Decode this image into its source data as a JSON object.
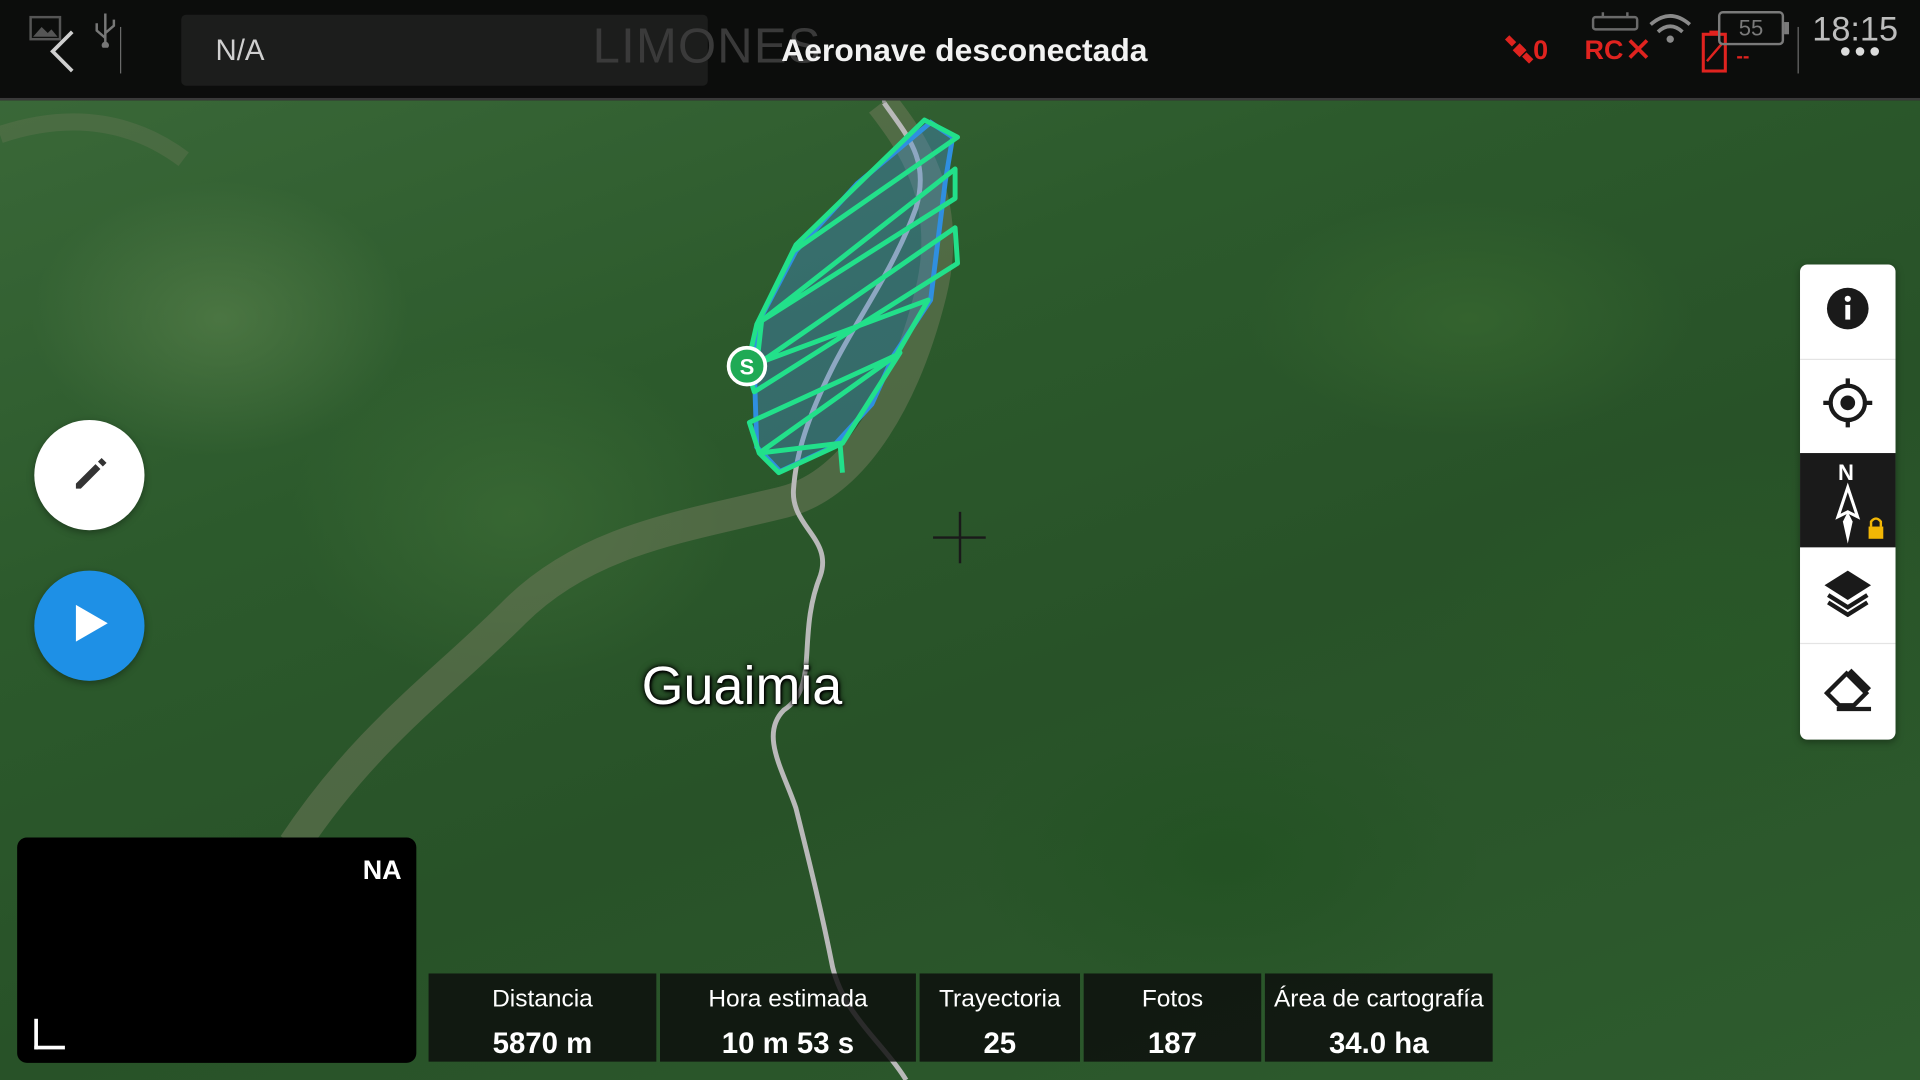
{
  "topbar": {
    "device_label": "N/A",
    "map_place": "LIMONES",
    "status": "Aeronave desconectada",
    "satellites": "0",
    "rc_label": "RC",
    "aircraft_battery": "--",
    "rc_battery": "55",
    "time": "18:15"
  },
  "map": {
    "place_label": "Guaimia",
    "start_marker": "S"
  },
  "mini_view": {
    "label": "NA"
  },
  "tools": [
    {
      "name": "info-icon"
    },
    {
      "name": "locate-icon"
    },
    {
      "name": "compass-north-lock-icon",
      "label": "N"
    },
    {
      "name": "map-layers-icon"
    },
    {
      "name": "eraser-icon"
    }
  ],
  "stats": {
    "distance_label": "Distancia",
    "distance_value": "5870 m",
    "time_label": "Hora estimada",
    "time_value": "10 m 53 s",
    "trajectory_label": "Trayectoria",
    "trajectory_value": "25",
    "photos_label": "Fotos",
    "photos_value": "187",
    "area_label": "Área de cartografía",
    "area_value": "34.0 ha"
  },
  "colors": {
    "accent_blue": "#1e90e6",
    "survey_area": "#2f8fe0",
    "flight_path": "#22e08a",
    "warning_red": "#e0231f"
  }
}
